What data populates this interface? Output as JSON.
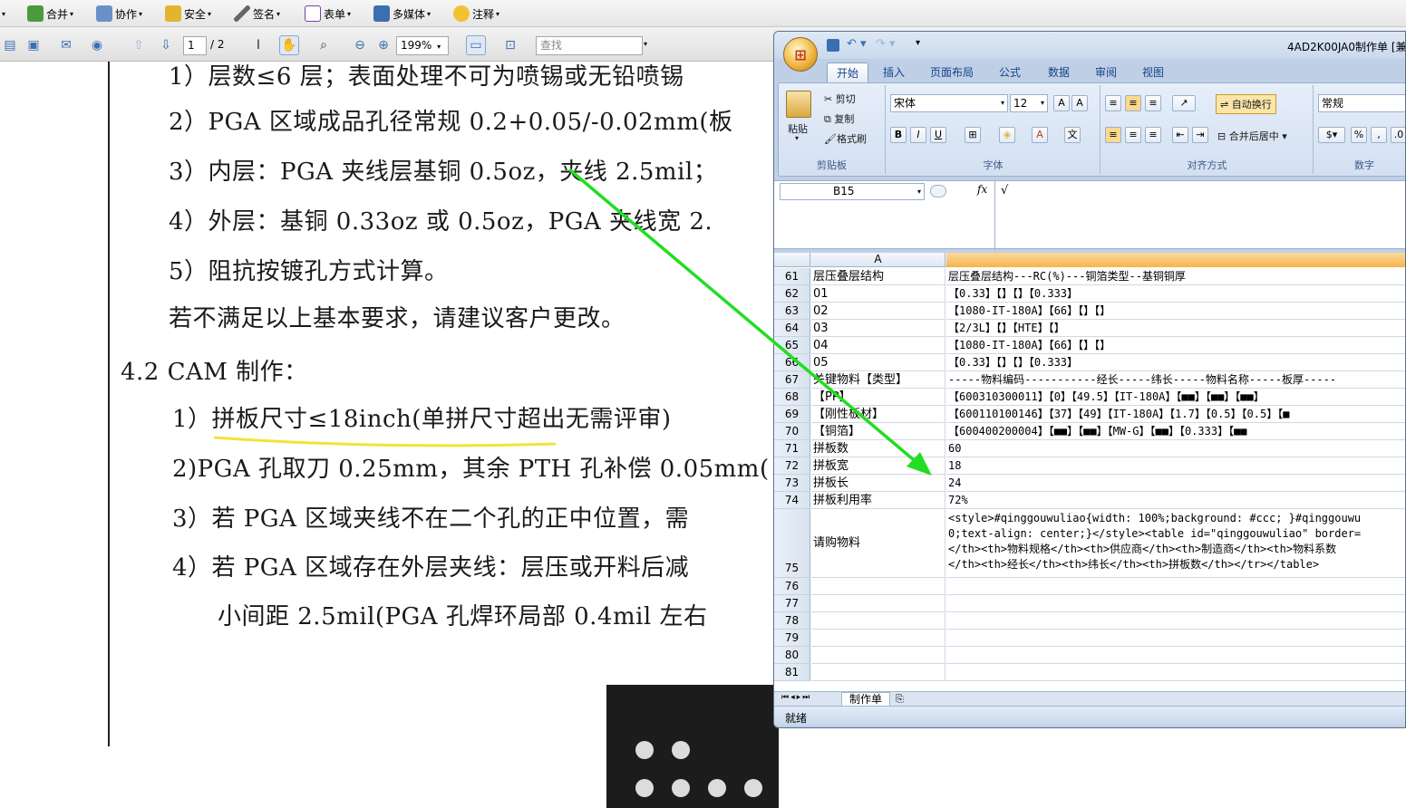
{
  "pdf_menu": [
    {
      "label": "合并",
      "name": "combine-menu"
    },
    {
      "label": "协作",
      "name": "collaborate-menu"
    },
    {
      "label": "安全",
      "name": "security-menu"
    },
    {
      "label": "签名",
      "name": "sign-menu"
    },
    {
      "label": "表单",
      "name": "forms-menu"
    },
    {
      "label": "多媒体",
      "name": "multimedia-menu"
    },
    {
      "label": "注释",
      "name": "comment-menu"
    }
  ],
  "pdf_tools": {
    "page_current": "1",
    "page_total": "/ 2",
    "zoom": "199%",
    "find_placeholder": "查找"
  },
  "document_lines": [
    "1）层数≤6 层；表面处理不可为喷锡或无铅喷锡",
    "2）PGA 区域成品孔径常规 0.2+0.05/-0.02mm(板",
    "3）内层：PGA 夹线层基铜 0.5oz，夹线 2.5mil；",
    "4）外层：基铜 0.33oz 或 0.5oz，PGA 夹线宽 2.",
    "5）阻抗按镀孔方式计算。",
    "若不满足以上基本要求，请建议客户更改。",
    "4.2 CAM 制作：",
    "1）拼板尺寸≤18inch(单拼尺寸超出无需评审)",
    "2)PGA 孔取刀 0.25mm，其余 PTH 孔补偿 0.05mm(",
    "3）若 PGA 区域夹线不在二个孔的正中位置，需",
    "4）若 PGA 区域存在外层夹线：层压或开料后减",
    "小间距 2.5mil(PGA 孔焊环局部 0.4mil 左右"
  ],
  "excel": {
    "title": "4AD2K00JA0制作单 [兼",
    "tabs": [
      "开始",
      "插入",
      "页面布局",
      "公式",
      "数据",
      "审阅",
      "视图"
    ],
    "clipboard": {
      "paste": "粘贴",
      "cut": "剪切",
      "copy": "复制",
      "format_painter": "格式刷",
      "label": "剪贴板"
    },
    "font": {
      "name": "宋体",
      "size": "12",
      "label": "字体"
    },
    "alignment": {
      "wrap": "自动换行",
      "merge": "合并后居中",
      "label": "对齐方式"
    },
    "number": {
      "format": "常规",
      "label": "数字"
    },
    "name_box": "B15",
    "fx": "fx",
    "formula_value": "√",
    "col_a": "A",
    "rows": [
      {
        "n": "61",
        "a": "层压叠层结构",
        "b": "层压叠层结构---RC(%)---铜箔类型--基铜铜厚"
      },
      {
        "n": "62",
        "a": "01",
        "b": "【0.33】【】【】【0.333】"
      },
      {
        "n": "63",
        "a": "02",
        "b": "【1080-IT-180A】【66】【】【】"
      },
      {
        "n": "64",
        "a": "03",
        "b": "【2/3L】【】【HTE】【】"
      },
      {
        "n": "65",
        "a": "04",
        "b": "【1080-IT-180A】【66】【】【】"
      },
      {
        "n": "66",
        "a": "05",
        "b": "【0.33】【】【】【0.333】"
      },
      {
        "n": "67",
        "a": "关键物料【类型】",
        "b": "-----物料编码-----------经长-----纬长-----物料名称-----板厚-----"
      },
      {
        "n": "68",
        "a": "【PP】",
        "b": "【600310300011】【0】【49.5】【IT-180A】【■■】【■■】【■■】"
      },
      {
        "n": "69",
        "a": "【刚性板材】",
        "b": "【600110100146】【37】【49】【IT-180A】【1.7】【0.5】【0.5】【■"
      },
      {
        "n": "70",
        "a": "【铜箔】",
        "b": "【600400200004】【■■】【■■】【MW-G】【■■】【0.333】【■■"
      },
      {
        "n": "71",
        "a": "拼板数",
        "b": "60"
      },
      {
        "n": "72",
        "a": "拼板宽",
        "b": "18"
      },
      {
        "n": "73",
        "a": "拼板长",
        "b": "24"
      },
      {
        "n": "74",
        "a": "拼板利用率",
        "b": "72%"
      }
    ],
    "row75": {
      "n": "75",
      "a": "请购物料",
      "b1": "<style>#qinggouwuliao{width: 100%;background: #ccc; }#qinggouwu",
      "b2": "0;text-align: center;}</style><table id=\"qinggouwuliao\" border=",
      "b3": "</th><th>物料规格</th><th>供应商</th><th>制造商</th><th>物料系数",
      "b4": "</th><th>经长</th><th>纬长</th><th>拼板数</th></tr></table>"
    },
    "empty_rows": [
      "76",
      "77",
      "78",
      "79",
      "80",
      "81"
    ],
    "sheet_tab": "制作单",
    "status": "就绪"
  },
  "colors": {
    "arrow": "#22dd22",
    "underline": "#f2e33a"
  }
}
